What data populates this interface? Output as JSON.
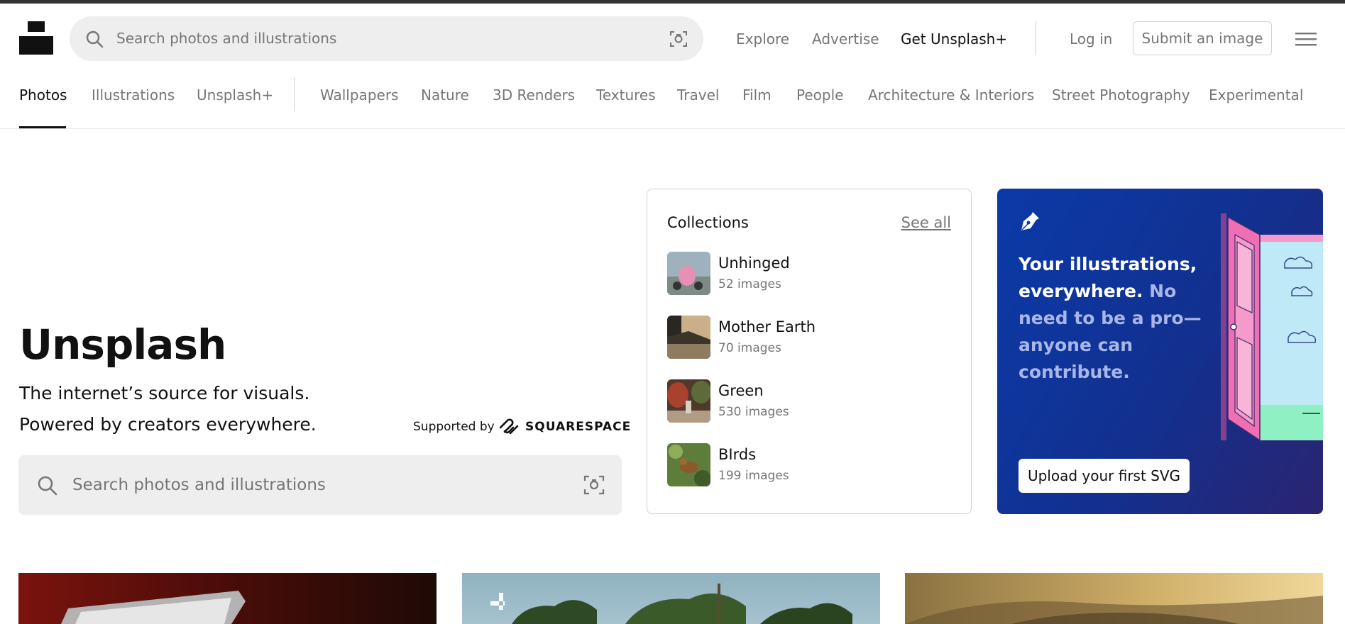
{
  "header": {
    "search_placeholder": "Search photos and illustrations",
    "nav": {
      "explore": "Explore",
      "advertise": "Advertise",
      "get_plus": "Get Unsplash+",
      "login": "Log in",
      "submit": "Submit an image"
    }
  },
  "tabs": {
    "primary": [
      "Photos",
      "Illustrations",
      "Unsplash+"
    ],
    "topics": [
      "Wallpapers",
      "Nature",
      "3D Renders",
      "Textures",
      "Travel",
      "Film",
      "People",
      "Architecture & Interiors",
      "Street Photography",
      "Experimental"
    ]
  },
  "hero": {
    "title": "Unsplash",
    "subtitle_line1": "The internet’s source for visuals.",
    "subtitle_line2": "Powered by creators everywhere.",
    "supported_by": "Supported by",
    "sponsor": "SQUARESPACE",
    "search_placeholder": "Search photos and illustrations"
  },
  "collections": {
    "title": "Collections",
    "see_all": "See all",
    "items": [
      {
        "name": "Unhinged",
        "count": "52 images"
      },
      {
        "name": "Mother Earth",
        "count": "70 images"
      },
      {
        "name": "Green",
        "count": "530 images"
      },
      {
        "name": "BIrds",
        "count": "199 images"
      }
    ]
  },
  "promo": {
    "line1": "Your illustrations,",
    "line2_white": "everywhere.",
    "line2_light": " No",
    "line3": "need to be a pro—",
    "line4": "anyone can",
    "line5": "contribute.",
    "button": "Upload your first SVG"
  },
  "colors": {
    "promo_blue": "#0b3aa8",
    "promo_light_text": "#a9b6e8",
    "search_bg": "#eeeeee",
    "muted_text": "#767676"
  }
}
